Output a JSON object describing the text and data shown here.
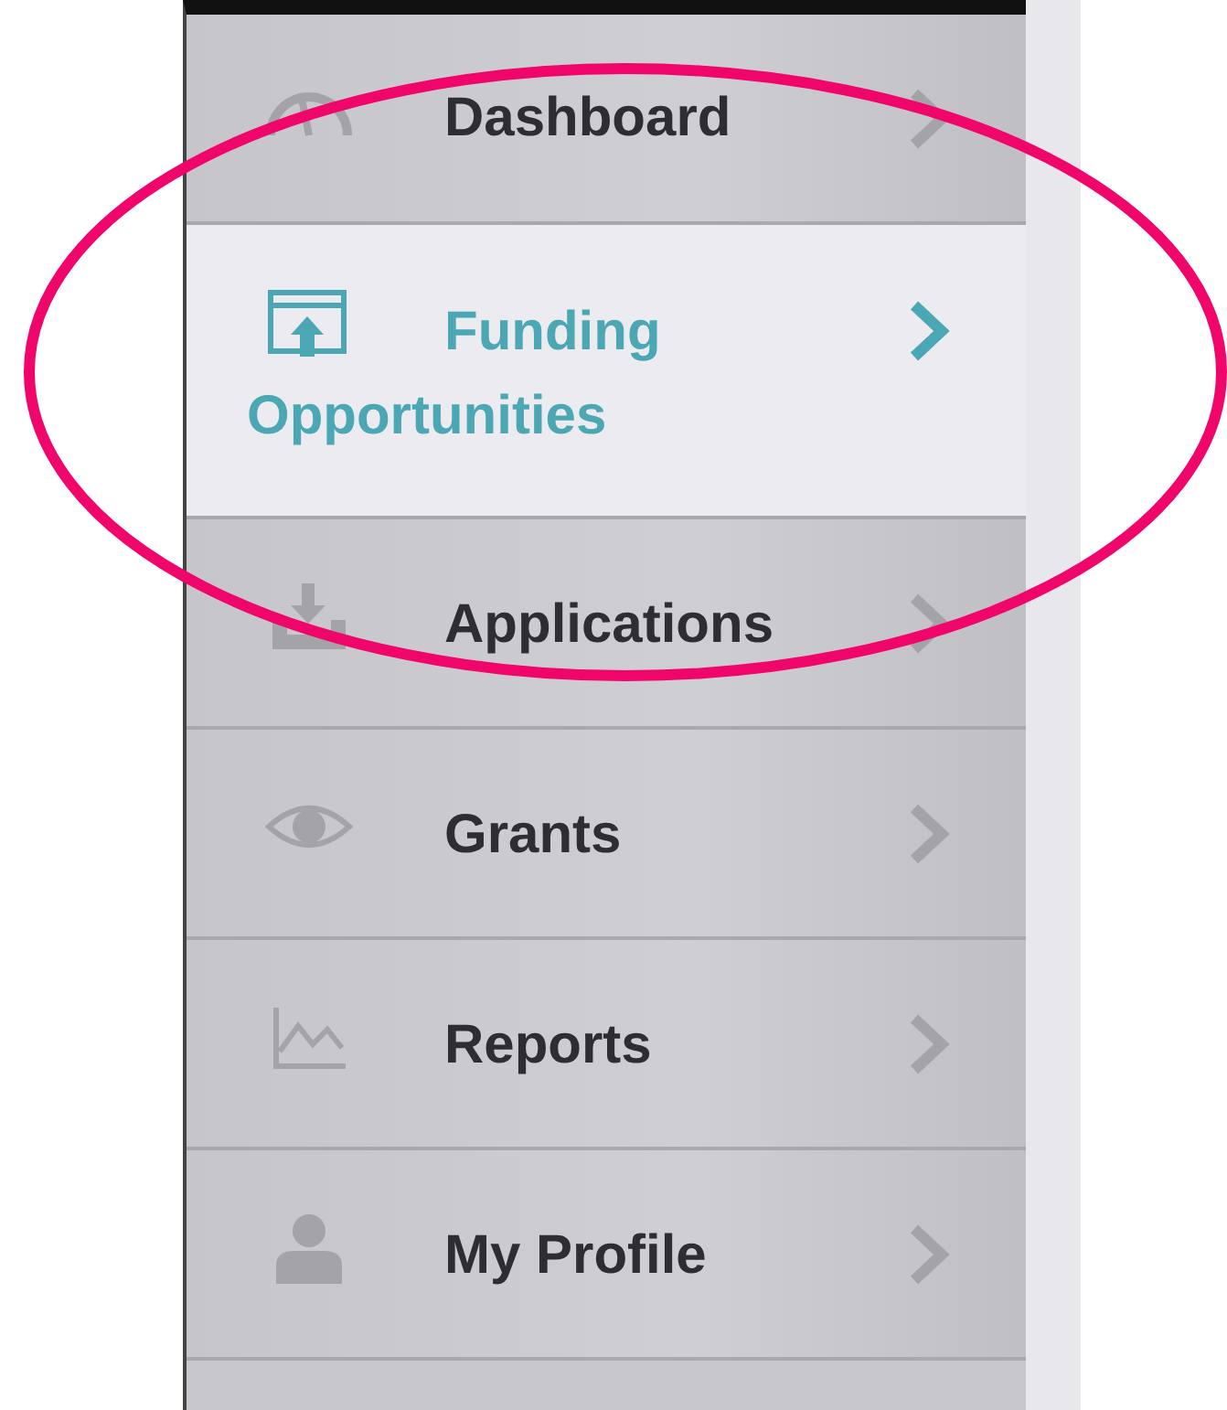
{
  "sidebar": {
    "items": [
      {
        "label": "Dashboard",
        "selected": false,
        "circled": false
      },
      {
        "label": "Funding Opportunities",
        "selected": true,
        "circled": true
      },
      {
        "label": "Applications",
        "selected": false,
        "circled": false
      },
      {
        "label": "Grants",
        "selected": false,
        "circled": false
      },
      {
        "label": "Reports",
        "selected": false,
        "circled": false
      },
      {
        "label": "My Profile",
        "selected": false,
        "circled": false
      }
    ]
  }
}
